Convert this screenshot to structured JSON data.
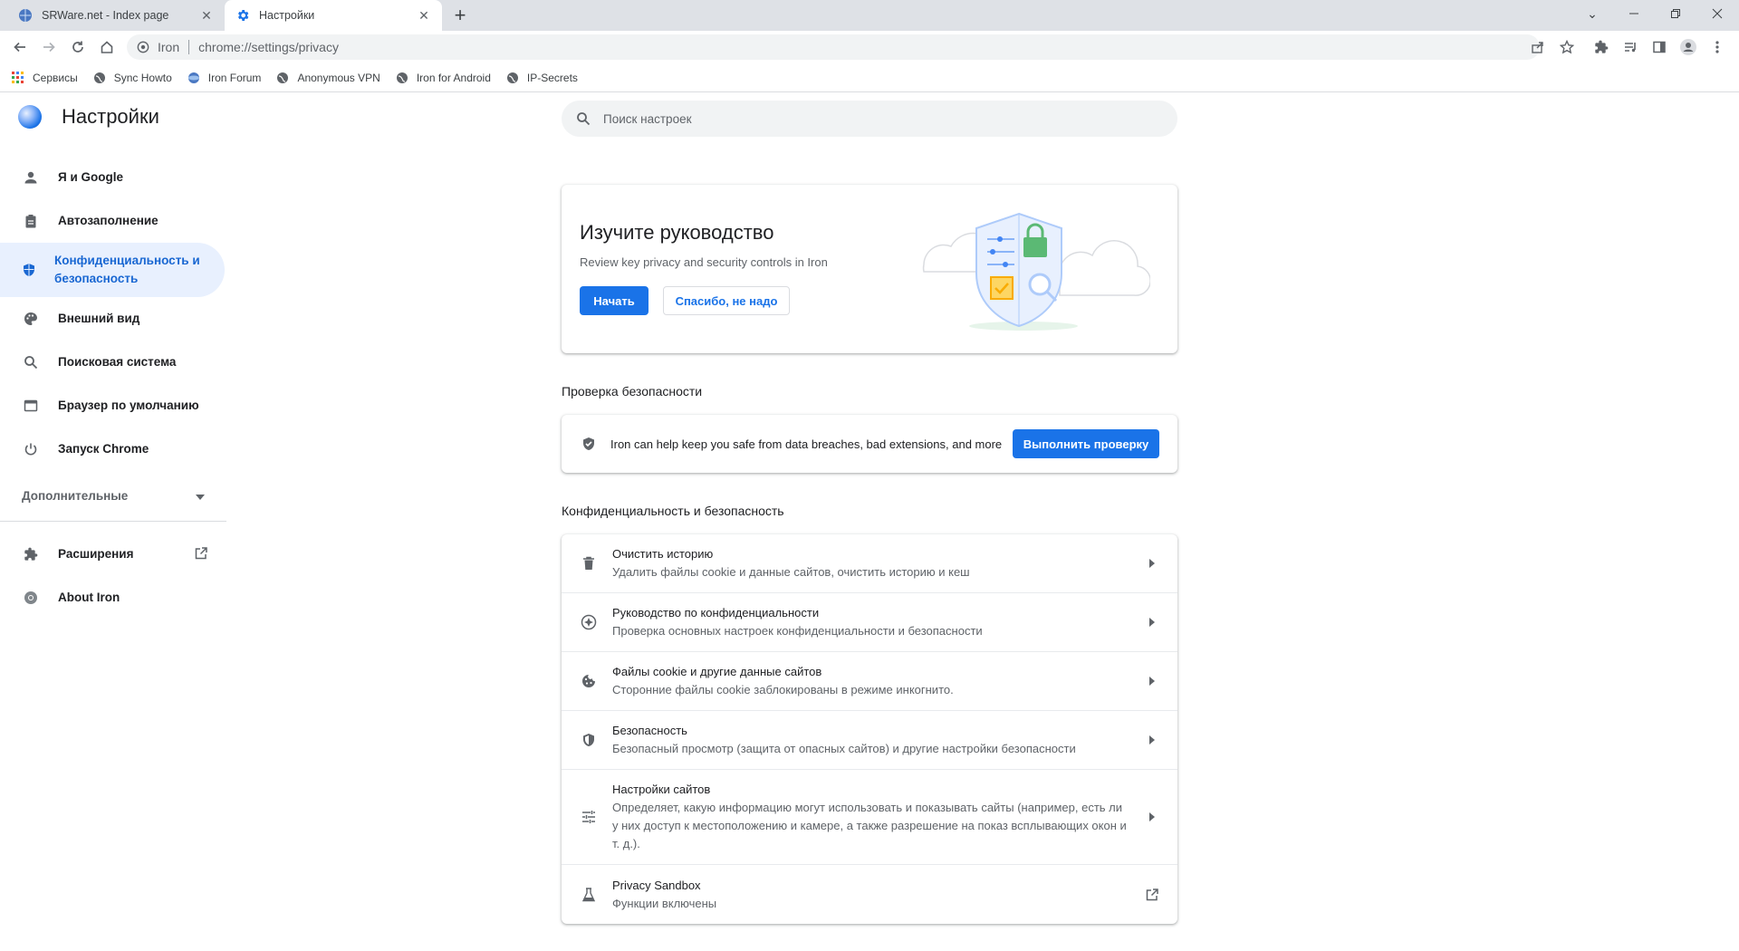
{
  "tabs": [
    {
      "title": "SRWare.net - Index page",
      "icon": "globe-iron-icon"
    },
    {
      "title": "Настройки",
      "icon": "gear-icon"
    }
  ],
  "toolbar": {
    "site_name": "Iron",
    "url": "chrome://settings/privacy"
  },
  "bookmarks": [
    {
      "label": "Сервисы",
      "icon": "apps-grid-icon"
    },
    {
      "label": "Sync Howto",
      "icon": "globe-icon"
    },
    {
      "label": "Iron Forum",
      "icon": "iron-icon"
    },
    {
      "label": "Anonymous VPN",
      "icon": "globe-icon"
    },
    {
      "label": "Iron for Android",
      "icon": "globe-icon"
    },
    {
      "label": "IP-Secrets",
      "icon": "globe-icon"
    }
  ],
  "settings": {
    "title": "Настройки",
    "search_placeholder": "Поиск настроек"
  },
  "nav": {
    "items": [
      {
        "label": "Я и Google",
        "icon": "person-icon"
      },
      {
        "label": "Автозаполнение",
        "icon": "clipboard-icon"
      },
      {
        "label": "Конфиденциальность и безопасность",
        "icon": "shield-icon"
      },
      {
        "label": "Внешний вид",
        "icon": "palette-icon"
      },
      {
        "label": "Поисковая система",
        "icon": "search-icon"
      },
      {
        "label": "Браузер по умолчанию",
        "icon": "browser-icon"
      },
      {
        "label": "Запуск Chrome",
        "icon": "power-icon"
      }
    ],
    "advanced": "Дополнительные",
    "extensions": "Расширения",
    "about": "About Iron"
  },
  "guide": {
    "title": "Изучите руководство",
    "subtitle": "Review key privacy and security controls in Iron",
    "start": "Начать",
    "no_thanks": "Спасибо, не надо"
  },
  "safety": {
    "heading": "Проверка безопасности",
    "text": "Iron can help keep you safe from data breaches, bad extensions, and more",
    "button": "Выполнить проверку"
  },
  "privacy": {
    "heading": "Конфиденциальность и безопасность",
    "rows": [
      {
        "title": "Очистить историю",
        "sub": "Удалить файлы cookie и данные сайтов, очистить историю и кеш",
        "icon": "trash-icon"
      },
      {
        "title": "Руководство по конфиденциальности",
        "sub": "Проверка основных настроек конфиденциальности и безопасности",
        "icon": "compass-icon"
      },
      {
        "title": "Файлы cookie и другие данные сайтов",
        "sub": "Сторонние файлы cookie заблокированы в режиме инкогнито.",
        "icon": "cookie-icon"
      },
      {
        "title": "Безопасность",
        "sub": "Безопасный просмотр (защита от опасных сайтов) и другие настройки безопасности",
        "icon": "security-shield-icon"
      },
      {
        "title": "Настройки сайтов",
        "sub": "Определяет, какую информацию могут использовать и показывать сайты (например, есть ли у них доступ к местоположению и камере, а также разрешение на показ всплывающих окон и т. д.).",
        "icon": "sliders-icon"
      },
      {
        "title": "Privacy Sandbox",
        "sub": "Функции включены",
        "icon": "flask-icon"
      }
    ]
  },
  "colors": {
    "accent": "#1a73e8",
    "nav_active_bg": "#e8f0fe",
    "nav_active_text": "#1967d2"
  }
}
